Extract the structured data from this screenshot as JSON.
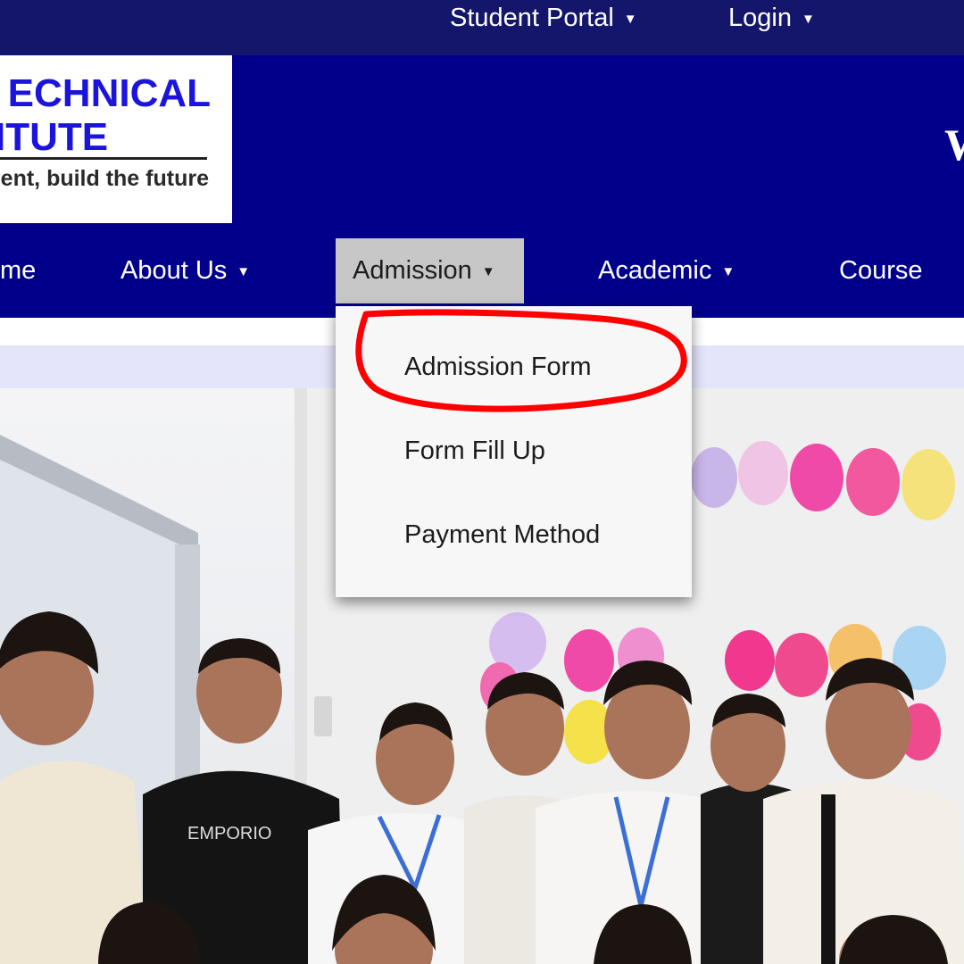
{
  "topbar": {
    "student_portal": "Student Portal",
    "login": "Login"
  },
  "logo": {
    "line1": "ECHNICAL",
    "line2": "ITUTE",
    "tagline": "ent, build the future"
  },
  "header": {
    "partial_heading": "W"
  },
  "nav": {
    "home": "me",
    "about": "About Us",
    "admission": "Admission",
    "academic": "Academic",
    "course": "Course"
  },
  "admission_menu": {
    "items": [
      "Admission Form",
      "Form Fill Up",
      "Payment Method"
    ]
  },
  "colors": {
    "topbar": "#14166b",
    "header": "#02008a",
    "active_nav": "#c7c7c7",
    "logo_text": "#1a14dc",
    "highlight_ring": "#ff0000"
  },
  "icons": {
    "caret": "caret-down-icon"
  }
}
